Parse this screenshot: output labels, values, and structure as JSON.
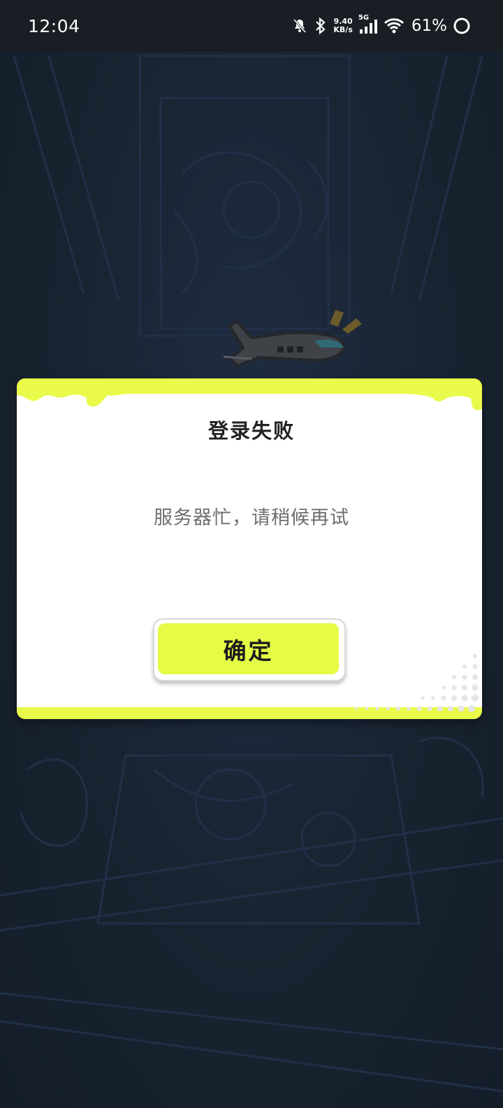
{
  "status_bar": {
    "time": "12:04",
    "net_speed_value": "9.40",
    "net_speed_unit": "KB/s",
    "network_type": "5G",
    "battery": "61%",
    "icons": [
      "bell-muted-icon",
      "bluetooth-icon",
      "cellular-signal-icon",
      "wifi-icon",
      "battery-ring-icon"
    ]
  },
  "dialog": {
    "title": "登录失败",
    "message": "服务器忙，请稍候再试",
    "confirm_label": "确定"
  },
  "colors": {
    "accent_yellow": "#e9fa4a",
    "background": "#1a2535",
    "statusbar": "#191e24"
  }
}
